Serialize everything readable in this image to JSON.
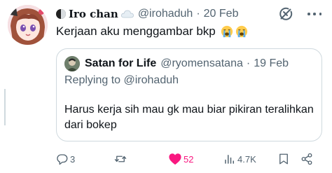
{
  "tweet": {
    "display_name": "Iro chan",
    "handle": "@irohaduh",
    "separator": "·",
    "date": "20 Feb",
    "text": "Kerjaan aku menggambar bkp",
    "emoji_icons": [
      "loudly-crying-face-icon",
      "loudly-crying-face-icon"
    ]
  },
  "quoted_tweet": {
    "display_name": "Satan for Life",
    "handle": "@ryomensatana",
    "separator": "·",
    "date": "19 Feb",
    "replying_to_prefix": "Replying to",
    "replying_to_handle": "@irohaduh",
    "text": "Harus kerja sih mau gk mau biar pikiran teralihkan dari bokep"
  },
  "actions": {
    "reply_count": "3",
    "retweet_count": "",
    "like_count": "52",
    "view_count": "4.7K"
  },
  "colors": {
    "like_accent": "#f91880",
    "muted_text": "#536471",
    "border": "#cfd9de"
  }
}
